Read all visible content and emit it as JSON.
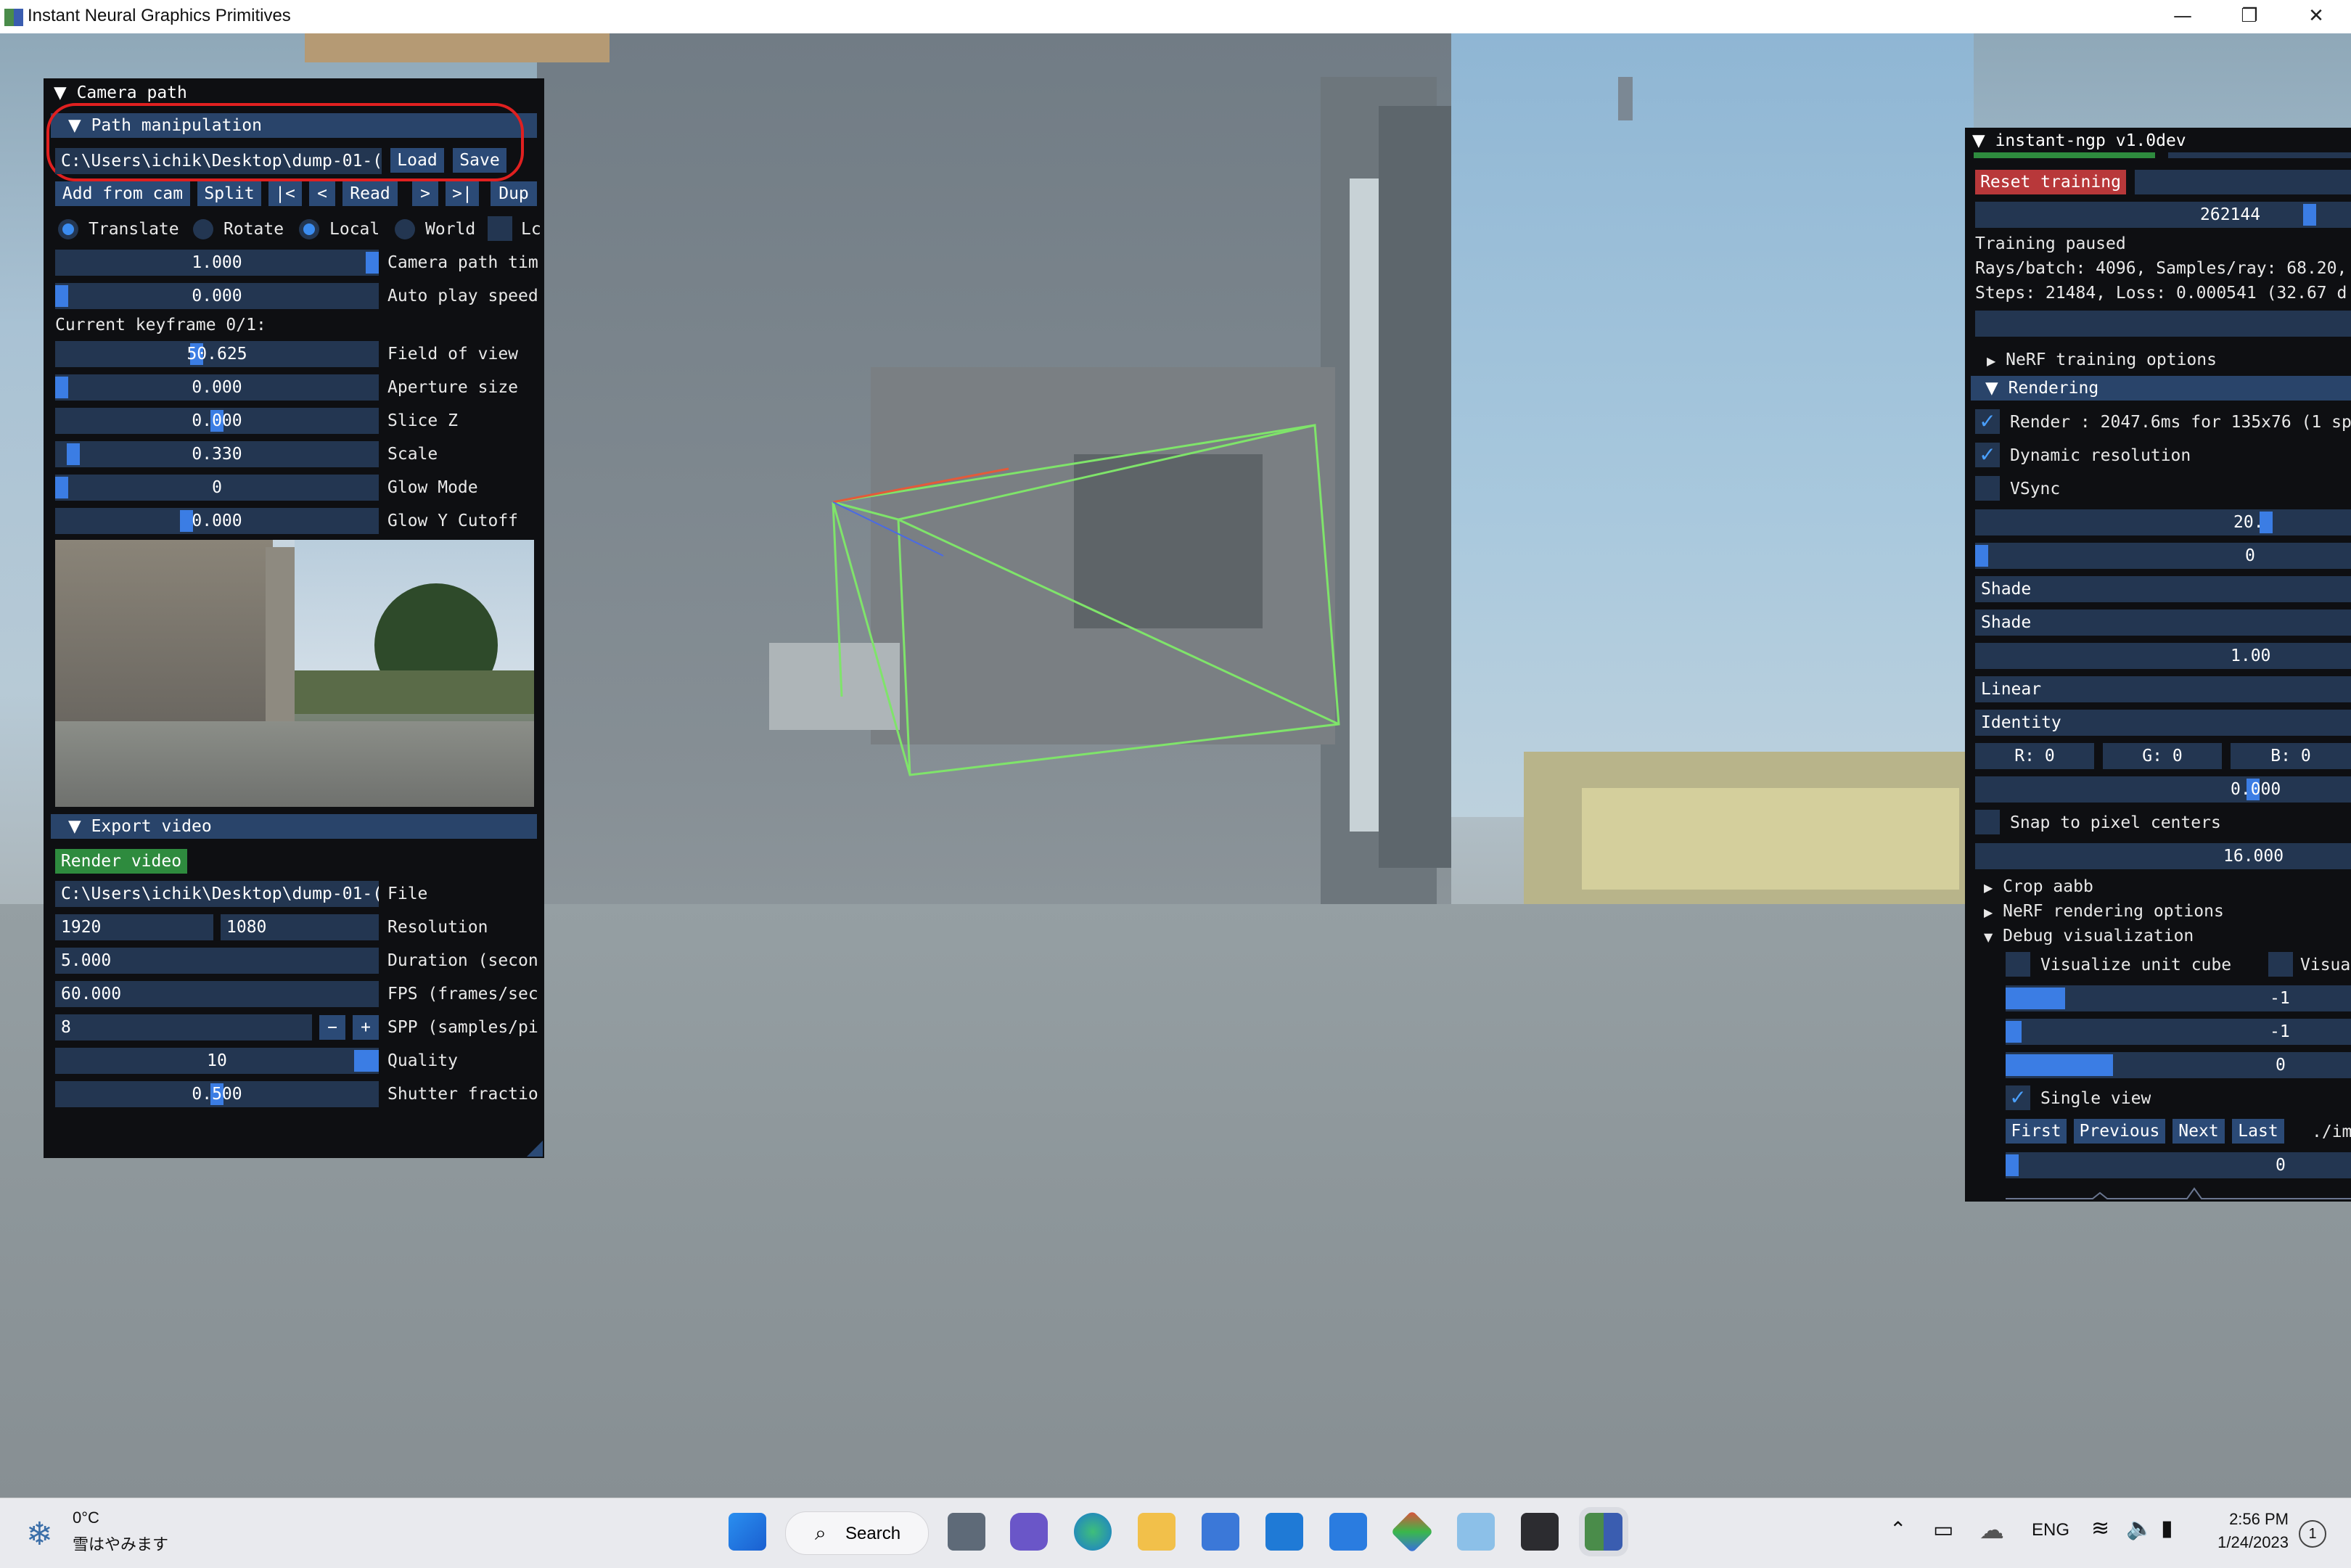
{
  "window": {
    "title": "Instant Neural Graphics Primitives",
    "minimize": "—",
    "maximize": "❐",
    "close": "✕"
  },
  "camera_window": {
    "title": "Camera path",
    "path_section": "Path manipulation",
    "path_value": "C:\\Users\\ichik\\Desktop\\dump-01-(",
    "load": "Load",
    "save": "Save",
    "buttons": [
      "Add from cam",
      "Split",
      "|<",
      "<",
      "Read",
      ">",
      ">|",
      "Dup"
    ],
    "radios": [
      "Translate",
      "Rotate",
      "Local",
      "World",
      "Lc"
    ],
    "rows": [
      {
        "value": "1.000",
        "label": "Camera path tim",
        "fill": 1.0
      },
      {
        "value": "0.000",
        "label": "Auto play speed",
        "fill": 0.0
      }
    ],
    "keyframe": "Current keyframe 0/1:",
    "keyframe_rows": [
      {
        "value": "50.625",
        "label": "Field of view",
        "fill": 0.42
      },
      {
        "value": "0.000",
        "label": "Aperture size",
        "fill": 0.0
      },
      {
        "value": "0.000",
        "label": "Slice Z",
        "fill": 0.5
      },
      {
        "value": "0.330",
        "label": "Scale",
        "fill": 0.05
      },
      {
        "value": "0",
        "label": "Glow Mode",
        "fill": 0.0
      },
      {
        "value": "0.000",
        "label": "Glow Y Cutoff",
        "fill": 0.4
      }
    ],
    "export_section": "Export video",
    "render_video": "Render video",
    "file_value": "C:\\Users\\ichik\\Desktop\\dump-01-(",
    "file_label": "File",
    "res_w": "1920",
    "res_h": "1080",
    "res_label": "Resolution",
    "duration_value": "5.000",
    "duration_label": "Duration (secon",
    "fps_value": "60.000",
    "fps_label": "FPS (frames/sec",
    "spp_value": "8",
    "spp_minus": "−",
    "spp_plus": "+",
    "spp_label": "SPP (samples/pi",
    "quality_value": "10",
    "quality_label": "Quality",
    "quality_fill": 1.0,
    "shutter_value": "0.500",
    "shutter_label": "Shutter fractio",
    "shutter_fill": 0.5
  },
  "ngp_window": {
    "title": "instant-ngp v1.0dev",
    "reset": "Reset training",
    "batch_value": "262144",
    "status1": "Training paused",
    "status2": "Rays/batch: 4096, Samples/ray: 68.20,",
    "status3": "Steps: 21484, Loss: 0.000541 (32.67 d",
    "nerf_training": "NeRF training options",
    "rendering": "Rendering",
    "render_chk": "Render  : 2047.6ms for 135x76 (1 sp",
    "dynres_chk": "Dynamic resolution",
    "vsync_chk": "VSync",
    "val_20": "20.0",
    "val_0a": "0",
    "shade1": "Shade",
    "shade2": "Shade",
    "val_1": "1.00",
    "linear": "Linear",
    "identity": "Identity",
    "r": "R:  0",
    "g": "G:  0",
    "b": "B:  0",
    "val_0b": "0.000",
    "snap_chk": "Snap to pixel centers",
    "val_16": "16.000",
    "crop": "Crop aabb",
    "nerf_rendering": "NeRF rendering options",
    "debug": "Debug visualization",
    "vis_cube": "Visualize unit cube",
    "vis_more": "Visuali",
    "neg1a": "-1",
    "neg1b": "-1",
    "zero_c": "0",
    "single_view": "Single view",
    "first": "First",
    "previous": "Previous",
    "next": "Next",
    "last": "Last",
    "path_tail": "./im",
    "zero_d": "0"
  },
  "taskbar": {
    "temp": "0°C",
    "weather": "雪はやみます",
    "search": "Search",
    "lang": "ENG",
    "time": "2:56 PM",
    "date": "1/24/2023",
    "badge": "1"
  }
}
